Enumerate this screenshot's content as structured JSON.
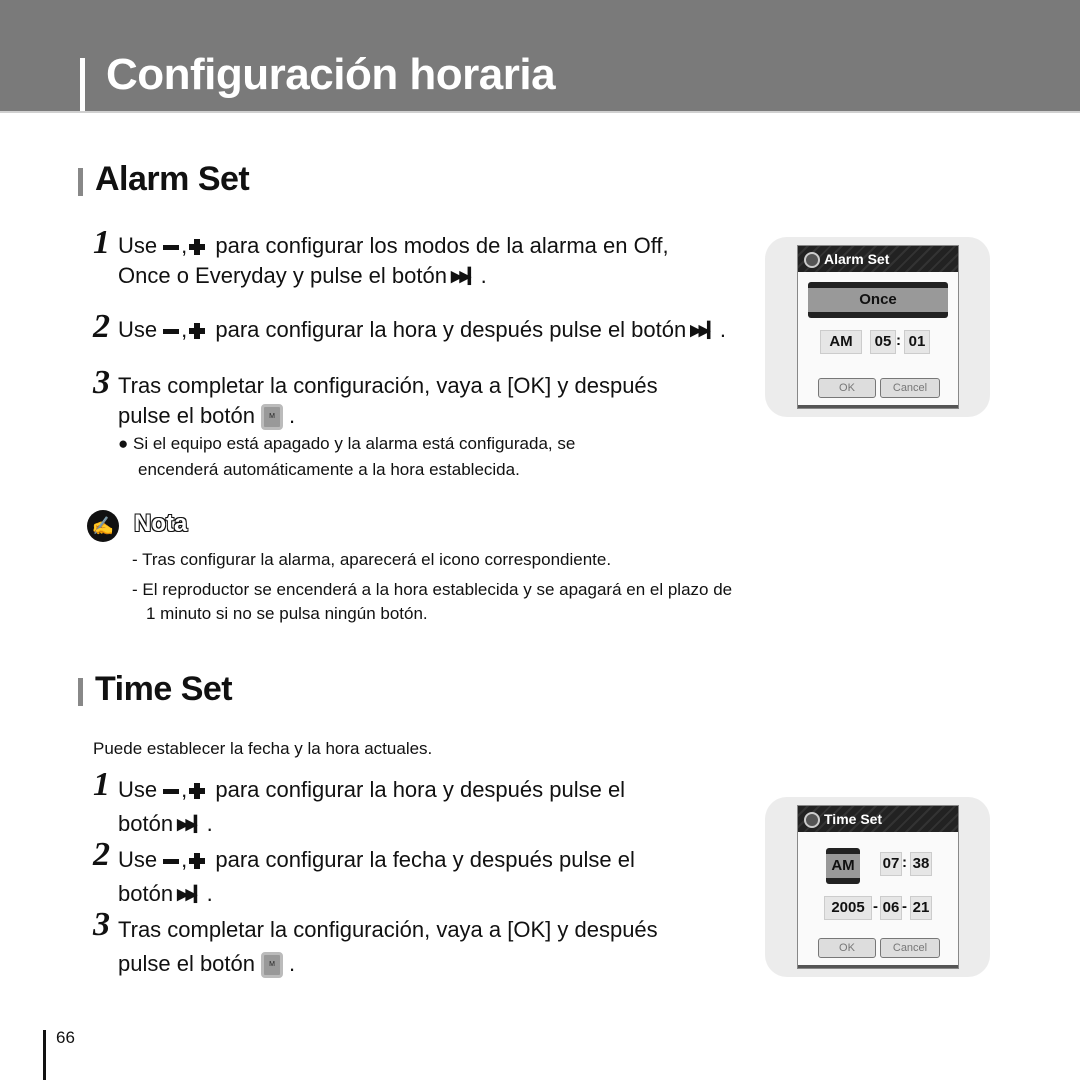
{
  "header": {
    "title": "Configuración horaria"
  },
  "alarm": {
    "title": "Alarm Set",
    "steps": [
      {
        "num": "1",
        "pre": "Use",
        "line1": "para configurar los modos de la alarma en Off,",
        "line2": "Once o Everyday y pulse el botón"
      },
      {
        "num": "2",
        "pre": "Use",
        "line1": "para configurar la hora y después pulse el botón"
      },
      {
        "num": "3",
        "line1": "Tras completar la configuración, vaya a [OK] y después",
        "line2": "pulse el botón"
      }
    ],
    "bullet": [
      "Si el equipo está apagado y la alarma está configurada, se",
      "encenderá automáticamente a la hora establecida."
    ],
    "screen": {
      "title": "Alarm Set",
      "mode": "Once",
      "ampm": "AM",
      "hour": "05",
      "minute": "01",
      "ok": "OK",
      "cancel": "Cancel"
    }
  },
  "nota": {
    "label": "Nota",
    "items": [
      "- Tras configurar la alarma, aparecerá el icono correspondiente.",
      "- El reproductor se encenderá a la hora establecida y se apagará en el plazo de",
      "1 minuto si no se pulsa ningún botón."
    ]
  },
  "time": {
    "title": "Time Set",
    "intro": "Puede establecer la fecha y la hora actuales.",
    "steps": [
      {
        "num": "1",
        "pre": "Use",
        "line1": "para configurar la hora y después pulse el",
        "line2": "botón"
      },
      {
        "num": "2",
        "pre": "Use",
        "line1": "para configurar la fecha y después pulse el",
        "line2": "botón"
      },
      {
        "num": "3",
        "line1": "Tras completar la configuración, vaya a [OK] y después",
        "line2": "pulse el botón"
      }
    ],
    "screen": {
      "title": "Time Set",
      "ampm": "AM",
      "hour": "07",
      "minute": "38",
      "year": "2005",
      "month": "06",
      "day": "21",
      "ok": "OK",
      "cancel": "Cancel"
    }
  },
  "icons": {
    "minus": "minus-button",
    "plus": "plus-button",
    "next": "⏭",
    "m": "M",
    "bullet": "●",
    "pen": "✍"
  },
  "page": {
    "number": "66"
  }
}
